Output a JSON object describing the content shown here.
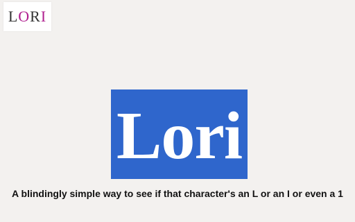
{
  "logo": {
    "letters": [
      "L",
      "O",
      "R",
      "I"
    ]
  },
  "hero": {
    "word": "Lori"
  },
  "tagline": "A blindingly simple way to see if that character's an L or an I or even a 1",
  "colors": {
    "background": "#f3f1ef",
    "hero_bg": "#2f66cc",
    "logo_accent": "#b01f8f"
  }
}
